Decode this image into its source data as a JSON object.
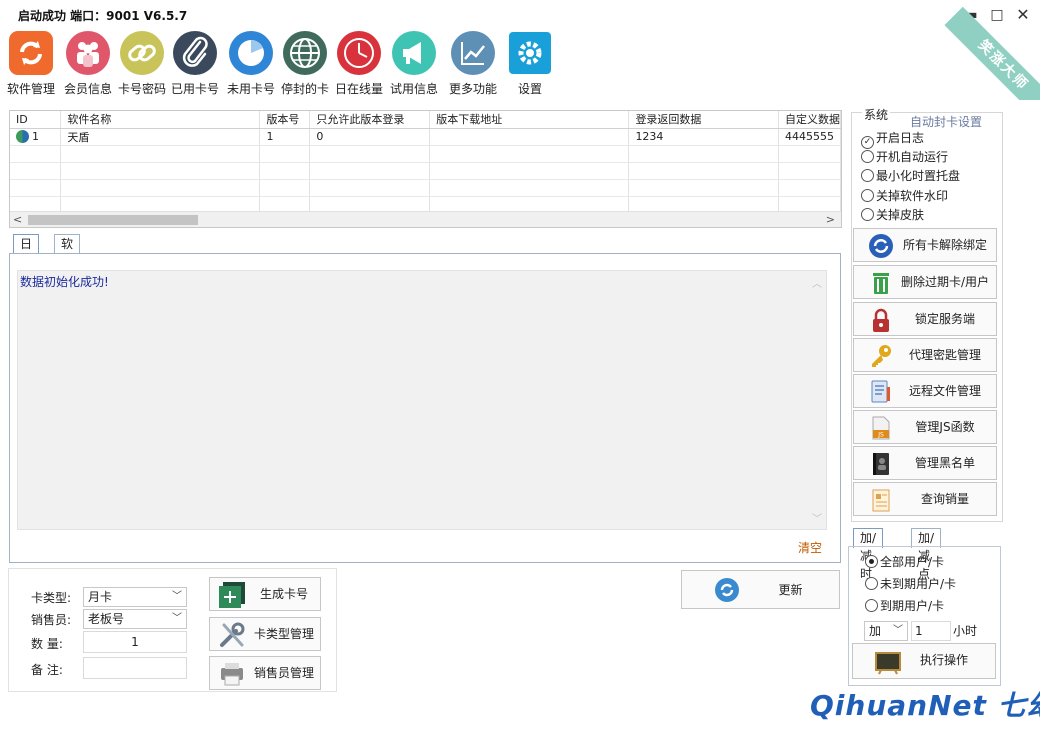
{
  "window": {
    "title": "启动成功  端口：9001 V6.5.7",
    "minimize": "▬",
    "maximize": "□",
    "close": "✕",
    "ribbon_text": "笑涨大师"
  },
  "toolbar": [
    {
      "label": "软件管理",
      "icon": "refresh-icon",
      "color": "#ef6a2c"
    },
    {
      "label": "会员信息",
      "icon": "users-icon",
      "color": "#e0566a"
    },
    {
      "label": "卡号密码",
      "icon": "link-icon",
      "color": "#c8c45a"
    },
    {
      "label": "已用卡号",
      "icon": "paperclip-icon",
      "color": "#3a4a5c"
    },
    {
      "label": "未用卡号",
      "icon": "pie-icon",
      "color": "#2f86d6"
    },
    {
      "label": "停封的卡",
      "icon": "globe-icon",
      "color": "#3f6a5c"
    },
    {
      "label": "日在线量",
      "icon": "clock-icon",
      "color": "#d8323c"
    },
    {
      "label": "试用信息",
      "icon": "megaphone-icon",
      "color": "#3fc4b4"
    },
    {
      "label": "更多功能",
      "icon": "trend-icon",
      "color": "#5e8fb4"
    },
    {
      "label": "设置",
      "icon": "gear-icon",
      "color": "#1aa0d8"
    }
  ],
  "grid": {
    "columns": [
      "ID",
      "软件名称",
      "版本号",
      "只允许此版本登录",
      "版本下载地址",
      "登录返回数据",
      "自定义数据"
    ],
    "rows": [
      [
        "1",
        "天盾",
        "1",
        "0",
        "",
        "1234",
        "4445555"
      ]
    ],
    "scroll_left": "<",
    "scroll_right": ">"
  },
  "tabs": {
    "log": "日志",
    "software_settings": "软件设置"
  },
  "log": {
    "message": "数据初始化成功!",
    "clear": "清空",
    "up": "︿",
    "down": "﹀"
  },
  "system": {
    "title": "系统",
    "auto_ban_link": "自动封卡设置",
    "options": [
      {
        "label": "开启日志",
        "checked": true
      },
      {
        "label": "开机自动运行",
        "checked": false
      },
      {
        "label": "最小化时置托盘",
        "checked": false
      },
      {
        "label": "关掉软件水印",
        "checked": false
      },
      {
        "label": "关掉皮肤",
        "checked": false
      }
    ],
    "check_glyph": "✓",
    "buttons": [
      {
        "label": "所有卡解除绑定",
        "icon": "unbind-icon",
        "color": "#2a5fb8"
      },
      {
        "label": "删除过期卡/用户",
        "icon": "trash-icon",
        "color": "#3aa04a"
      },
      {
        "label": "锁定服务端",
        "icon": "lock-icon",
        "color": "#b83232"
      },
      {
        "label": "代理密匙管理",
        "icon": "key-icon",
        "color": "#e0a81a"
      },
      {
        "label": "远程文件管理",
        "icon": "document-icon",
        "color": "#5a86c8"
      },
      {
        "label": "管理JS函数",
        "icon": "js-file-icon",
        "color": "#e08a1a"
      },
      {
        "label": "管理黑名单",
        "icon": "blacklist-book-icon",
        "color": "#333333"
      },
      {
        "label": "查询销量",
        "icon": "report-icon",
        "color": "#e0a050"
      }
    ]
  },
  "time_ops": {
    "tab_add_sub_time": "加/减时",
    "tab_add_sub_points": "加/减点",
    "options": [
      {
        "label": "全部用户/卡",
        "selected": true
      },
      {
        "label": "未到期用户/卡",
        "selected": false
      },
      {
        "label": "到期用户/卡",
        "selected": false
      }
    ],
    "op_select": "加",
    "amount": "1",
    "unit": "小时",
    "execute": "执行操作"
  },
  "form": {
    "card_type_label": "卡类型:",
    "card_type_value": "月卡",
    "seller_label": "销售员:",
    "seller_value": "老板号",
    "quantity_label": "数   量:",
    "quantity_value": "1",
    "remark_label": "备   注:",
    "remark_value": "",
    "generate": "生成卡号",
    "card_type_manage": "卡类型管理",
    "seller_manage": "销售员管理"
  },
  "update": {
    "label": "更新"
  },
  "brand": {
    "text": "QihuanNet 七幻"
  }
}
